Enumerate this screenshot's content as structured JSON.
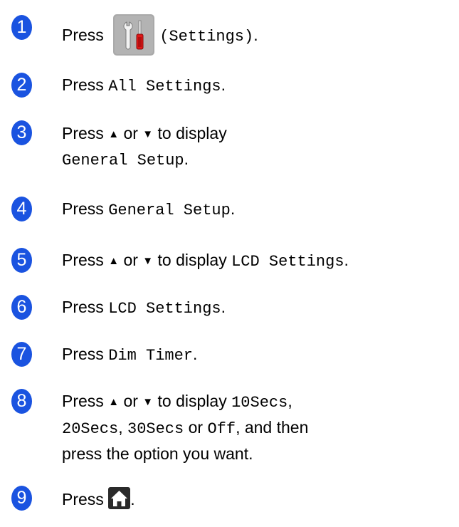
{
  "colors": {
    "badge": "#1a53e0",
    "icon_bg": "#a9a9a9",
    "home_bg": "#2a2a2a"
  },
  "icons": {
    "settings": "settings-icon",
    "home": "home-icon",
    "up": "up-triangle-icon",
    "down": "down-triangle-icon"
  },
  "steps": [
    {
      "number": "1",
      "press": "Press",
      "label": "(Settings)",
      "end": "."
    },
    {
      "number": "2",
      "press": "Press",
      "label": "All Settings",
      "end": "."
    },
    {
      "number": "3",
      "press": "Press",
      "up": "▲",
      "or": "or",
      "down": "▼",
      "to_display": "to display",
      "label": "General Setup",
      "end": "."
    },
    {
      "number": "4",
      "press": "Press",
      "label": "General Setup",
      "end": "."
    },
    {
      "number": "5",
      "press": "Press",
      "up": "▲",
      "or": "or",
      "down": "▼",
      "to_display": "to display",
      "label": "LCD Settings",
      "end": "."
    },
    {
      "number": "6",
      "press": "Press",
      "label": "LCD Settings",
      "end": "."
    },
    {
      "number": "7",
      "press": "Press",
      "label": "Dim Timer",
      "end": "."
    },
    {
      "number": "8",
      "press": "Press",
      "up": "▲",
      "or": "or",
      "down": "▼",
      "to_display": "to display",
      "opt1": "10Secs",
      "opt2": "20Secs",
      "opt3": "30Secs",
      "or_word": "or",
      "opt4": "Off",
      "and_then": ", and then",
      "line3": "press the option you want.",
      "comma": ","
    },
    {
      "number": "9",
      "press": "Press",
      "end": "."
    }
  ]
}
